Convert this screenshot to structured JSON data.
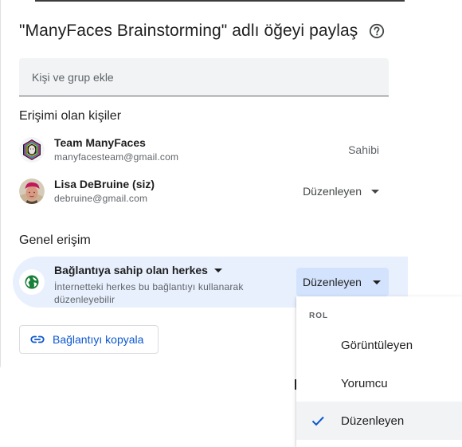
{
  "dialog": {
    "title": "\"ManyFaces Brainstorming\" adlı öğeyi paylaş",
    "help_icon": "help-circle-icon",
    "add_input_placeholder": "Kişi ve grup ekle"
  },
  "people_section": {
    "heading": "Erişimi olan kişiler",
    "people": [
      {
        "name": "Team ManyFaces",
        "email": "manyfacesteam@gmail.com",
        "role": "Sahibi"
      },
      {
        "name": "Lisa DeBruine (siz)",
        "email": "debruine@gmail.com",
        "role": "Düzenleyen"
      }
    ]
  },
  "general_access": {
    "heading": "Genel erişim",
    "scope": "Bağlantıya sahip olan herkes",
    "description": "İnternetteki herkes bu bağlantıyı kullanarak düzenleyebilir",
    "role": "Düzenleyen",
    "icon": "globe-icon",
    "accent": "#188038"
  },
  "copy_link": {
    "label": "Bağlantıyı kopyala",
    "icon": "link-icon",
    "color": "#0b57d0"
  },
  "role_menu": {
    "heading": "ROL",
    "options": [
      "Görüntüleyen",
      "Yorumcu",
      "Düzenleyen"
    ],
    "selected": "Düzenleyen"
  }
}
